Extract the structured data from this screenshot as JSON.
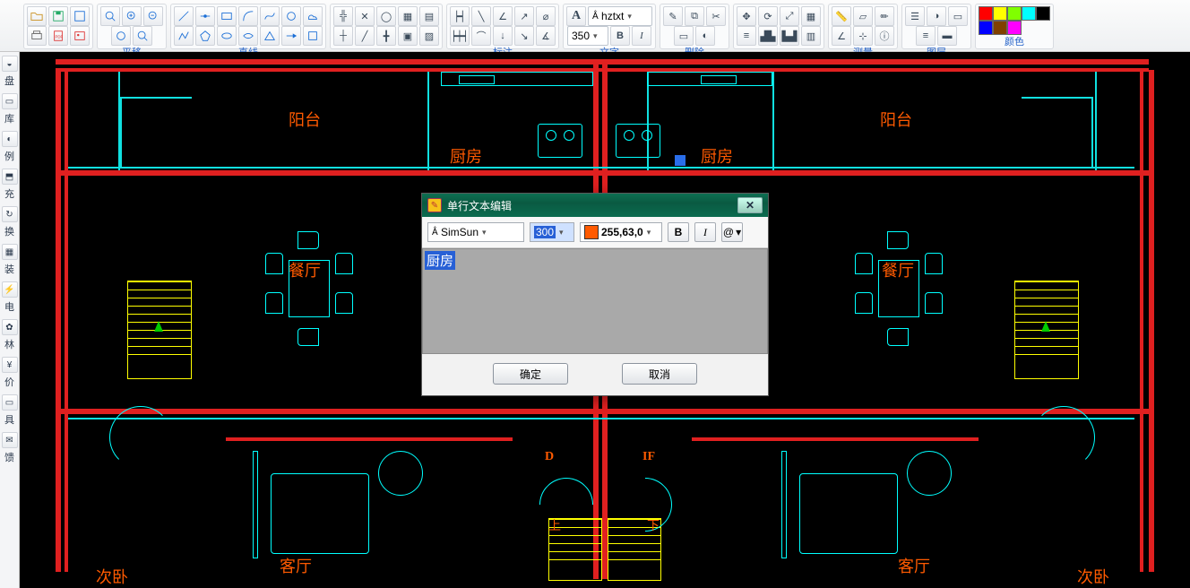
{
  "toolbar": {
    "groups": {
      "pan": {
        "label": "平移"
      },
      "line": {
        "label": "直线"
      },
      "annot": {
        "label": "标注"
      },
      "text": {
        "label": "文字",
        "font_style": "hztxt",
        "height": "350"
      },
      "delete": {
        "label": "删除"
      },
      "measure": {
        "label": "测量"
      },
      "layers": {
        "label": "图层"
      },
      "color": {
        "label": "颜色"
      }
    },
    "bold": "B",
    "italic": "I",
    "palette": [
      "#ff0000",
      "#ffff00",
      "#80ff00",
      "#00ffff",
      "#000000",
      "#0000ff",
      "#804000",
      "#ff00ff"
    ]
  },
  "sidebar": {
    "items": [
      "盘",
      "库",
      "例",
      "充",
      "换",
      "装",
      "电",
      "林",
      "价",
      "具",
      "馈"
    ]
  },
  "drawing": {
    "rooms": {
      "balcony1": "阳台",
      "balcony2": "阳台",
      "kitchen1": "厨房",
      "kitchen2": "厨房",
      "dining1": "餐厅",
      "dining2": "餐厅",
      "living1": "客厅",
      "living2": "客厅",
      "bed1": "次卧",
      "bed2": "次卧",
      "up": "上",
      "down": "下",
      "D": "D",
      "IF": "IF"
    }
  },
  "dialog": {
    "title": "单行文本编辑",
    "font": "SimSun",
    "size": "300",
    "color": "255,63,0",
    "bold": "B",
    "italic": "I",
    "at": "@",
    "text": "厨房",
    "ok": "确定",
    "cancel": "取消"
  }
}
